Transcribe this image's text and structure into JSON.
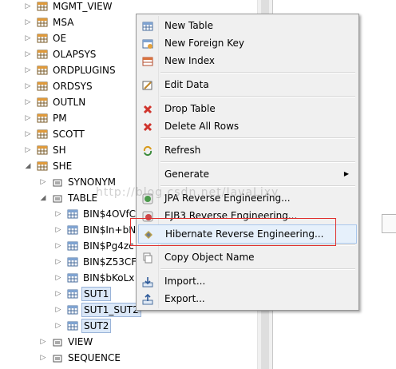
{
  "tree": {
    "items": [
      {
        "label": "MGMT_VIEW",
        "icon": "schema-icon",
        "expanded": false
      },
      {
        "label": "MSA",
        "icon": "schema-icon",
        "expanded": false
      },
      {
        "label": "OE",
        "icon": "schema-icon",
        "expanded": false
      },
      {
        "label": "OLAPSYS",
        "icon": "schema-icon",
        "expanded": false
      },
      {
        "label": "ORDPLUGINS",
        "icon": "schema-icon",
        "expanded": false
      },
      {
        "label": "ORDSYS",
        "icon": "schema-icon",
        "expanded": false
      },
      {
        "label": "OUTLN",
        "icon": "schema-icon",
        "expanded": false
      },
      {
        "label": "PM",
        "icon": "schema-icon",
        "expanded": false
      },
      {
        "label": "SCOTT",
        "icon": "schema-icon",
        "expanded": false
      },
      {
        "label": "SH",
        "icon": "schema-icon",
        "expanded": false
      },
      {
        "label": "SHE",
        "icon": "schema-icon",
        "expanded": true
      },
      {
        "label": "SYNONYM",
        "icon": "folder-icon",
        "expanded": false
      },
      {
        "label": "TABLE",
        "icon": "folder-icon",
        "expanded": true
      },
      {
        "label": "BIN$4OVfC",
        "icon": "table-icon",
        "expanded": false
      },
      {
        "label": "BIN$In+bN",
        "icon": "table-icon",
        "expanded": false
      },
      {
        "label": "BIN$Pg4zc",
        "icon": "table-icon",
        "expanded": false
      },
      {
        "label": "BIN$Z53CF",
        "icon": "table-icon",
        "expanded": false
      },
      {
        "label": "BIN$bKoLx",
        "icon": "table-icon",
        "expanded": false
      },
      {
        "label": "SUT1",
        "icon": "table-icon",
        "expanded": false,
        "selected": true
      },
      {
        "label": "SUT1_SUT2",
        "icon": "table-icon",
        "expanded": false,
        "selected": true
      },
      {
        "label": "SUT2",
        "icon": "table-icon",
        "expanded": false,
        "selected": true
      },
      {
        "label": "VIEW",
        "icon": "folder-icon",
        "expanded": false
      },
      {
        "label": "SEQUENCE",
        "icon": "folder-icon",
        "expanded": false
      }
    ]
  },
  "menu": {
    "items": [
      {
        "label": "New Table",
        "icon": "new-table-icon"
      },
      {
        "label": "New Foreign Key",
        "icon": "new-foreign-key-icon"
      },
      {
        "label": "New Index",
        "icon": "new-index-icon"
      },
      {
        "label": "Edit Data",
        "icon": "edit-data-icon"
      },
      {
        "label": "Drop Table",
        "icon": "drop-table-icon"
      },
      {
        "label": "Delete All Rows",
        "icon": "delete-rows-icon"
      },
      {
        "label": "Refresh",
        "icon": "refresh-icon"
      },
      {
        "label": "Generate",
        "icon": "",
        "submenu": true
      },
      {
        "label": "JPA Reverse Engineering...",
        "icon": "jpa-icon"
      },
      {
        "label": "EJB3 Reverse Engineering...",
        "icon": "ejb3-icon"
      },
      {
        "label": "Hibernate Reverse Engineering...",
        "icon": "hibernate-icon",
        "highlighted": true
      },
      {
        "label": "Copy Object Name",
        "icon": "copy-icon"
      },
      {
        "label": "Import...",
        "icon": "import-icon"
      },
      {
        "label": "Export...",
        "icon": "export-icon"
      }
    ],
    "submenu_arrow": "▶"
  },
  "watermark": "http://blog.csdn.net/JavaLixy",
  "colors": {
    "highlight_border": "#e0302e",
    "selection": "#dbe8f8",
    "menu_bg": "#f0f0f0"
  }
}
